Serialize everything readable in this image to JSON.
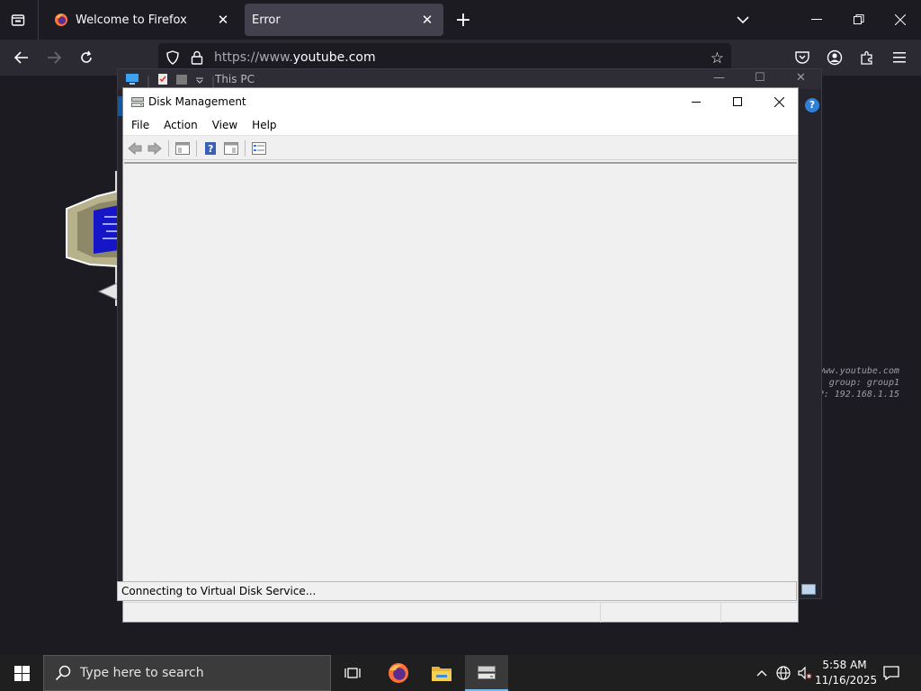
{
  "browser": {
    "tabs": [
      {
        "title": "Welcome to Firefox",
        "active": false
      },
      {
        "title": "Error",
        "active": true
      }
    ],
    "url_prefix": "https://www.",
    "url_domain": "youtube.com"
  },
  "background_page": {
    "router_lines": [
      "www.youtube.com",
      "group: group1",
      "P: 192.168.1.15"
    ]
  },
  "explorer_window": {
    "title": "This PC",
    "help_label": "?"
  },
  "disk_management": {
    "title": "Disk Management",
    "menu": [
      "File",
      "Action",
      "View",
      "Help"
    ],
    "status_message": "Connecting to Virtual Disk Service..."
  },
  "taskbar": {
    "search_placeholder": "Type here to search",
    "time": "5:58 AM",
    "date": "11/16/2025"
  },
  "colors": {
    "firefox_dark": "#1c1b22",
    "firefox_toolbar": "#2b2a33",
    "active_tab": "#42414d",
    "taskbar": "#1f1f1f",
    "accent": "#76b9ed"
  }
}
